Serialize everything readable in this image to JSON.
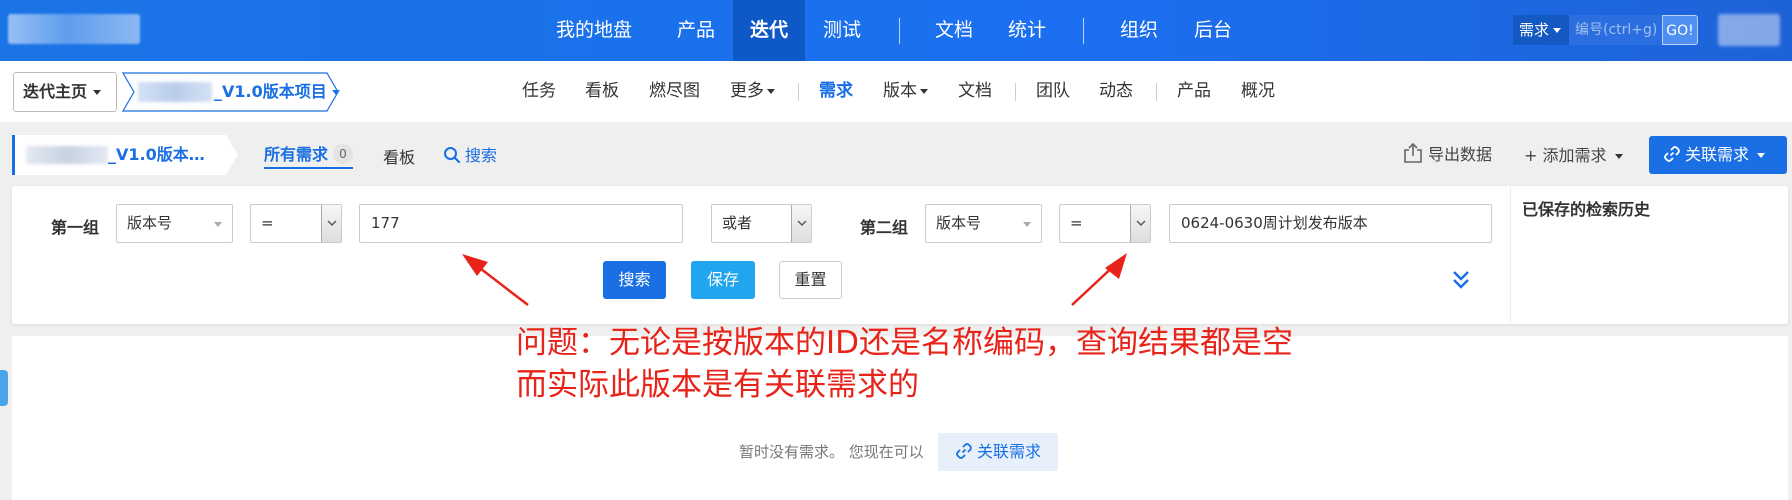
{
  "topnav": {
    "items": [
      "我的地盘",
      "产品",
      "迭代",
      "测试",
      "文档",
      "统计",
      "组织",
      "后台"
    ],
    "active_index": 2,
    "product_select": "需求",
    "search_placeholder": "编号(ctrl+g)",
    "go_label": "GO!"
  },
  "subnav": {
    "home_label": "迭代主页",
    "project_suffix": "_V1.0版本项目",
    "items": [
      "任务",
      "看板",
      "燃尽图",
      "更多",
      "需求",
      "版本",
      "文档",
      "团队",
      "动态",
      "产品",
      "概况"
    ],
    "active_index": 4
  },
  "toolbar": {
    "pill_suffix": "_V1.0版本…",
    "all_tab": "所有需求",
    "all_count": "0",
    "board_tab": "看板",
    "search_tab": "搜索",
    "export_label": "导出数据",
    "add_label": "+ 添加需求",
    "link_label": "关联需求"
  },
  "search": {
    "group1_label": "第一组",
    "group1_field": "版本号",
    "group1_op": "=",
    "group1_value": "177",
    "logic": "或者",
    "group2_label": "第二组",
    "group2_field": "版本号",
    "group2_op": "=",
    "group2_value": "0624-0630周计划发布版本",
    "search_button": "搜索",
    "save_button": "保存",
    "reset_button": "重置",
    "saved_title": "已保存的检索历史"
  },
  "annotation": {
    "line1": "问题：无论是按版本的ID还是名称编码，查询结果都是空",
    "line2": "而实际此版本是有关联需求的",
    "color": "#e8231a"
  },
  "empty_state": {
    "text": "暂时没有需求。 您现在可以",
    "link_label": "关联需求"
  },
  "colors": {
    "primary": "#1a6fe4",
    "topbar": "#1b6ff0",
    "save": "#20a5ee"
  }
}
